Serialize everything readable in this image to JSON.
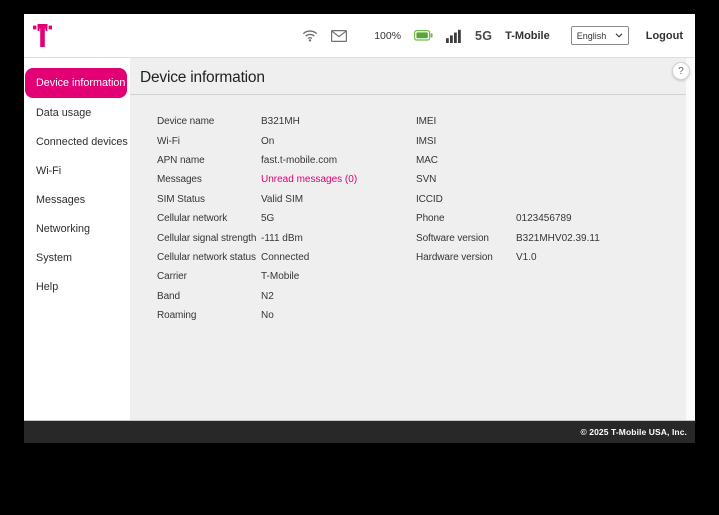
{
  "header": {
    "battery_level": "100%",
    "network_type": "5G",
    "carrier_name": "T-Mobile",
    "language": {
      "selected": "English"
    },
    "logout_label": "Logout"
  },
  "sidebar": {
    "items": [
      {
        "label": "Device information",
        "active": true
      },
      {
        "label": "Data usage"
      },
      {
        "label": "Connected devices"
      },
      {
        "label": "Wi-Fi"
      },
      {
        "label": "Messages"
      },
      {
        "label": "Networking"
      },
      {
        "label": "System"
      },
      {
        "label": "Help"
      }
    ]
  },
  "main": {
    "title": "Device information",
    "help_button": "?",
    "left_rows": [
      {
        "label": "Device name",
        "value": "B321MH"
      },
      {
        "label": "Wi-Fi",
        "value": "On"
      },
      {
        "label": "APN name",
        "value": "fast.t-mobile.com"
      },
      {
        "label": "Messages",
        "value": "Unread messages (0)",
        "link": true
      },
      {
        "label": "SIM Status",
        "value": "Valid SIM"
      },
      {
        "label": "Cellular network",
        "value": "5G"
      },
      {
        "label": "Cellular signal strength",
        "value": "-111 dBm"
      },
      {
        "label": "Cellular network status",
        "value": "Connected"
      },
      {
        "label": "Carrier",
        "value": "T-Mobile"
      },
      {
        "label": "Band",
        "value": "N2"
      },
      {
        "label": "Roaming",
        "value": "No"
      }
    ],
    "right_rows": [
      {
        "label": "IMEI",
        "value": ""
      },
      {
        "label": "IMSI",
        "value": ""
      },
      {
        "label": "MAC",
        "value": ""
      },
      {
        "label": "SVN",
        "value": ""
      },
      {
        "label": "ICCID",
        "value": ""
      },
      {
        "label": "Phone",
        "value": "0123456789"
      },
      {
        "label": "Software version",
        "value": "B321MHV02.39.11"
      },
      {
        "label": "Hardware version",
        "value": "V1.0"
      }
    ]
  },
  "footer": {
    "copyright": "© 2025 T-Mobile USA, Inc."
  },
  "colors": {
    "brand_magenta": "#e20074",
    "battery_green": "#61ad37",
    "content_bg": "#efefef",
    "footer_bg": "#282828"
  },
  "icons": {
    "logo": "t-mobile-logo",
    "wifi": "wifi-icon",
    "mail": "envelope-icon",
    "battery": "battery-icon",
    "signal": "signal-bars-icon",
    "language_chevron": "chevron-down-icon",
    "help": "question-mark-icon"
  }
}
